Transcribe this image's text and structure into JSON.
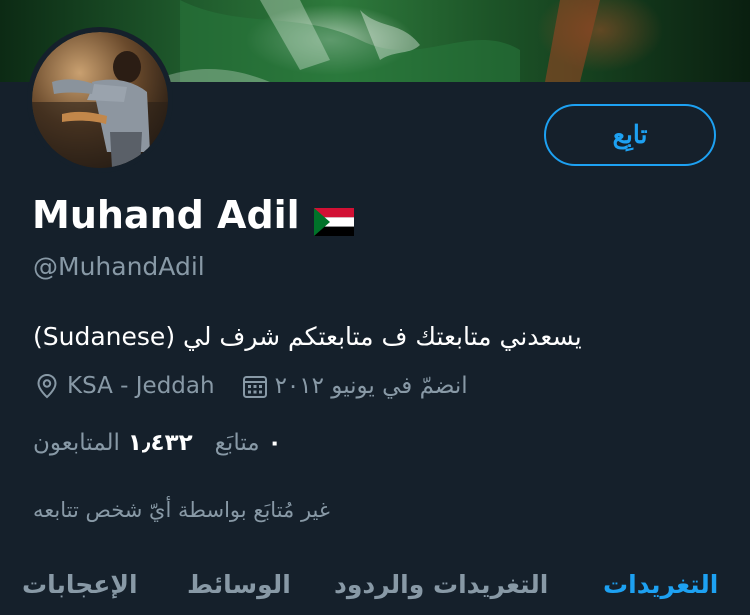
{
  "profile": {
    "follow_label": "تابِع",
    "name": "Muhand Adil",
    "handle": "@MuhandAdil",
    "bio": "يسعدني متابعتك ف متابعتكم شرف لي (Sudanese)",
    "location": "KSA - Jeddah",
    "joined": "انضمّ في يونيو ٢٠١٢",
    "following_count": "٠",
    "following_label": "متابَع",
    "followers_count": "١٫٤٣٢",
    "followers_label": "المتابعون",
    "not_followed_text": "غير مُتابَع بواسطة أيّ شخص تتابعه"
  },
  "tabs": [
    {
      "label": "التغريدات",
      "active": true
    },
    {
      "label": "التغريدات والردود",
      "active": false
    },
    {
      "label": "الوسائط",
      "active": false
    },
    {
      "label": "الإعجابات",
      "active": false
    }
  ],
  "colors": {
    "background": "#15202b",
    "accent": "#1da1f2",
    "secondary_text": "#8899a6"
  },
  "icons": {
    "location": "location-pin-icon",
    "calendar": "calendar-icon",
    "flag": "sudan-flag-icon"
  }
}
